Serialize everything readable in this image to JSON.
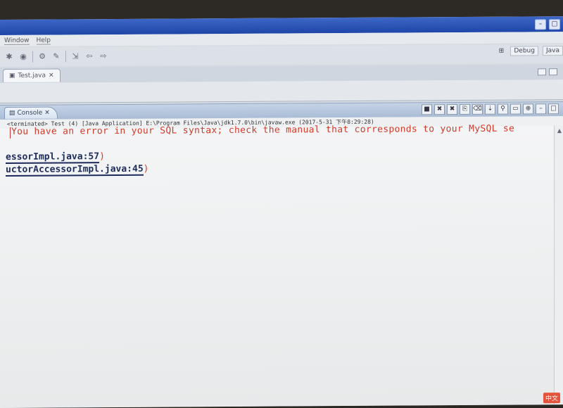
{
  "menu": {
    "items": [
      "Window",
      "Help"
    ]
  },
  "toolbar": {
    "icons": [
      "bug-icon",
      "run-icon",
      "external-tools-icon",
      "new-icon",
      "navigate-icon",
      "back-icon",
      "forward-icon"
    ]
  },
  "perspectives": {
    "debug_label": "Debug",
    "java_label": "Java"
  },
  "editor": {
    "tab_label": "Test.java"
  },
  "console": {
    "tab_label": "Console",
    "status_line": "<terminated> Test (4) [Java Application] E:\\Program Files\\Java\\jdk1.7.0\\bin\\javaw.exe (2017-5-31 下午8:29:28)",
    "error_line": "You have an error in your SQL syntax; check the manual that corresponds to your MySQL se",
    "trace_lines": [
      {
        "link": "essorImpl.java:57",
        "suffix": ")"
      },
      {
        "link": "uctorAccessorImpl.java:45",
        "suffix": ")"
      }
    ]
  },
  "tray": {
    "label": "中文"
  },
  "colors": {
    "error": "#d13a2a",
    "link": "#1d2b5c",
    "title_bar": "#1e46a8"
  }
}
